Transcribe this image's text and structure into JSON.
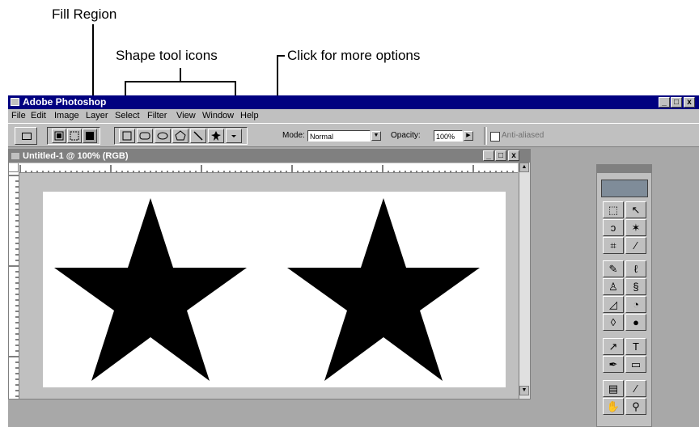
{
  "callouts": {
    "fill_region": "Fill Region",
    "shape_tool_icons": "Shape tool icons",
    "more_options": "Click for more options"
  },
  "app": {
    "title": "Adobe Photoshop",
    "window_buttons": [
      "_",
      "□",
      "x"
    ]
  },
  "menu": [
    "File",
    "Edit",
    "Image",
    "Layer",
    "Select",
    "Filter",
    "View",
    "Window",
    "Help"
  ],
  "options_bar": {
    "mode_label": "Mode:",
    "mode_value": "Normal",
    "opacity_label": "Opacity:",
    "opacity_value": "100%",
    "antialiased_label": "Anti-aliased"
  },
  "document": {
    "title": "Untitled-1 @ 100% (RGB)",
    "window_buttons": [
      "_",
      "□",
      "x"
    ]
  },
  "colors": {
    "app_titlebar": "#000080",
    "chrome": "#c0c0c0",
    "workspace": "#a8a8a8",
    "doc_titlebar": "#808080"
  },
  "icons": {
    "rectangle_tool": "rectangle-icon",
    "rounded_rectangle_tool": "rounded-rectangle-icon",
    "ellipse_tool": "ellipse-icon",
    "polygon_tool": "polygon-icon",
    "line_tool": "line-icon",
    "custom_shape_tool": "custom-shape-icon"
  }
}
